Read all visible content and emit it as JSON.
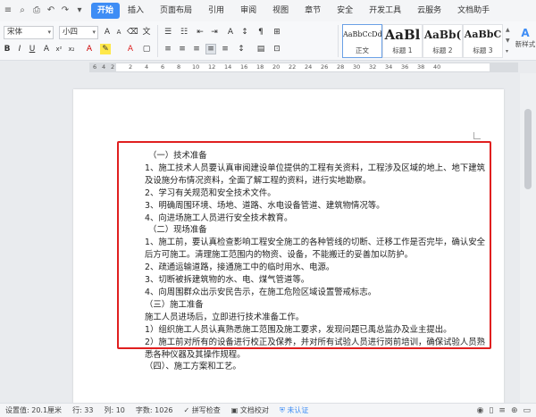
{
  "menubar": {
    "quick_icons": [
      "≡",
      "⌕",
      "⎙",
      "↶",
      "↷",
      "▾"
    ],
    "items": [
      "开始",
      "插入",
      "页面布局",
      "引用",
      "审阅",
      "视图",
      "章节",
      "安全",
      "开发工具",
      "云服务",
      "文档助手"
    ],
    "active": "开始"
  },
  "ribbon": {
    "font_name": "宋体",
    "font_size": "小四",
    "style_gallery": [
      {
        "sample": "AaBbCcDd",
        "name": "正文"
      },
      {
        "sample": "AaBl",
        "name": "标题 1"
      },
      {
        "sample": "AaBb(",
        "name": "标题 2"
      },
      {
        "sample": "AaBbC",
        "name": "标题 3"
      }
    ],
    "new_style_label": "新样式"
  },
  "ruler": {
    "ticks": [
      "6",
      "4",
      "2",
      "2",
      "4",
      "6",
      "8",
      "10",
      "12",
      "14",
      "16",
      "18",
      "20",
      "22",
      "24",
      "26",
      "28",
      "30",
      "32",
      "34",
      "36",
      "38",
      "40"
    ]
  },
  "document": {
    "lines": [
      "（一）技术准备",
      "1、施工技术人员要认真审阅建设单位提供的工程有关资料，工程涉及区域的地上、地下建筑及设施分布情况资料，全面了解工程的资料，进行实地勘察。",
      "2、学习有关规范和安全技术文件。",
      "3、明确周围环境、场地、道路、水电设备管道、建筑物情况等。",
      "4、向进场施工人员进行安全技术教育。",
      "（二）现场准备",
      "1、施工前，要认真检查影响工程安全施工的各种管线的切断、迁移工作是否完毕，确认安全后方可施工。清理施工范围内的物资、设备，不能搬迁的妥善加以防护。",
      "2、疏通运输道路，接通施工中的临时用水、电源。",
      "3、切断被拆建筑物的水、电、煤气管道等。",
      "4、向周围群众出示安民告示，在施工危险区域设置警戒标志。",
      "（三）施工准备",
      "施工人员进场后，立即进行技术准备工作。",
      "1）组织施工人员认真熟悉施工范围及施工要求，发现问题已禹总监办及业主提出。",
      "2）施工前对所有的设备进行校正及保养，并对所有试验人员进行岗前培训，确保试验人员熟悉各种仪器及其操作规程。",
      "（四）、施工方案和工艺。"
    ]
  },
  "statusbar": {
    "position": "设置值: 20.1厘米",
    "row": "行: 33",
    "col": "列: 10",
    "words": "字数: 1026",
    "spell": "拼写检查",
    "proof": "文档校对",
    "auth": "未认证",
    "colors": {
      "accent": "#3e8df5",
      "highlight": "#e01f1f"
    }
  }
}
